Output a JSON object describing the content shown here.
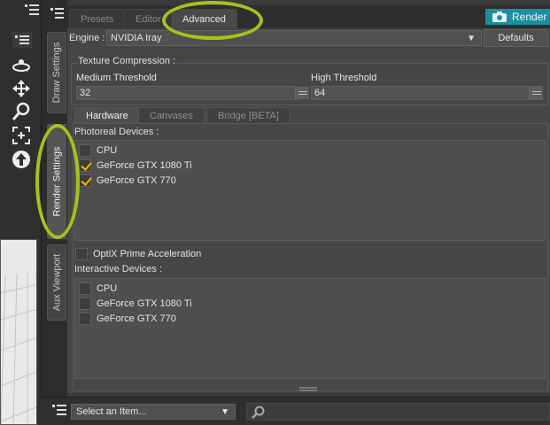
{
  "tabs": [
    {
      "label": "Presets",
      "active": false
    },
    {
      "label": "Editor",
      "active": false
    },
    {
      "label": "Advanced",
      "active": true
    }
  ],
  "render_button": {
    "label": "Render",
    "icon": "camera-icon",
    "color": "#1a8fa0"
  },
  "vertical_tabs": [
    {
      "label": "Draw Settings",
      "active": false
    },
    {
      "label": "Render Settings",
      "active": true
    },
    {
      "label": "Aux Viewport",
      "active": false
    }
  ],
  "engine": {
    "label": "Engine :",
    "value": "NVIDIA Iray",
    "defaults_label": "Defaults"
  },
  "texture_compression": {
    "title": "Texture Compression :",
    "medium": {
      "label": "Medium Threshold",
      "value": "32"
    },
    "high": {
      "label": "High Threshold",
      "value": "64"
    }
  },
  "sub_tabs": [
    {
      "label": "Hardware",
      "active": true
    },
    {
      "label": "Canvases",
      "active": false
    },
    {
      "label": "Bridge [BETA]",
      "active": false
    }
  ],
  "photoreal": {
    "title": "Photoreal Devices :",
    "devices": [
      {
        "name": "CPU",
        "checked": false
      },
      {
        "name": "GeForce GTX 1080 Ti",
        "checked": true
      },
      {
        "name": "GeForce GTX 770",
        "checked": true
      }
    ]
  },
  "optix": {
    "label": "OptiX Prime Acceleration",
    "checked": false
  },
  "interactive": {
    "title": "Interactive Devices :",
    "devices": [
      {
        "name": "CPU",
        "checked": false
      },
      {
        "name": "GeForce GTX 1080 Ti",
        "checked": false
      },
      {
        "name": "GeForce GTX 770",
        "checked": false
      }
    ]
  },
  "bottom": {
    "select_placeholder": "Select an Item..."
  },
  "colors": {
    "annotation": "#a7c21b",
    "checkmark": "#f0b400",
    "accent": "#1a8fa0"
  }
}
